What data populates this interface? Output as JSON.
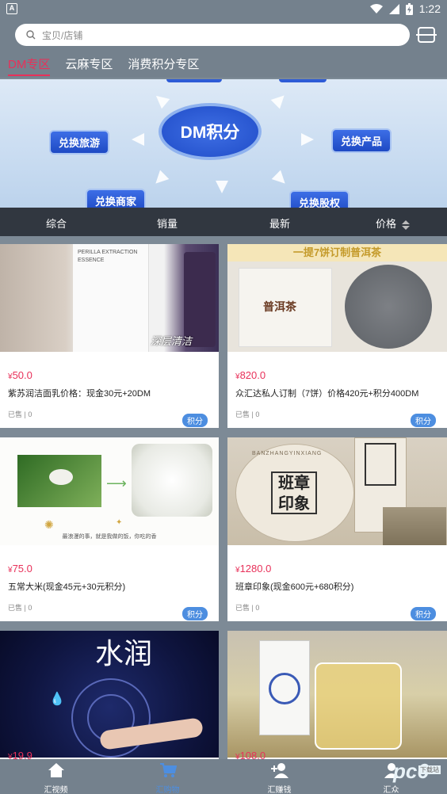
{
  "status_bar": {
    "time": "1:22",
    "notification_letter": "A"
  },
  "search": {
    "placeholder": "宝贝/店铺"
  },
  "tabs": [
    {
      "label": "DM专区",
      "active": true
    },
    {
      "label": "云麻专区",
      "active": false
    },
    {
      "label": "消费积分专区",
      "active": false
    }
  ],
  "banner": {
    "center": "DM积分",
    "pills": [
      "兑换旅游",
      "兑换商家",
      "兑换产品",
      "兑换股权"
    ]
  },
  "sort_bar": {
    "items": [
      "综合",
      "销量",
      "最新",
      "价格"
    ]
  },
  "products": [
    {
      "price": "50.0",
      "currency": "¥",
      "title": "紫苏润洁面乳价格：现金30元+20DM",
      "sold": "已售 | 0",
      "badge": "积分",
      "img_text": "深层清洁",
      "img_label": "PERILLA EXTRACTION ESSENCE"
    },
    {
      "price": "820.0",
      "currency": "¥",
      "title": "众汇达私人订制（7饼）价格420元+积分400DM",
      "sold": "已售 | 0",
      "badge": "积分",
      "img_text": "一提7饼订制普洱茶",
      "img_label": "普洱茶"
    },
    {
      "price": "75.0",
      "currency": "¥",
      "title": "五常大米(现金45元+30元积分)",
      "sold": "已售 | 0",
      "badge": "积分",
      "img_text": "最浪漫的事，就是我做的饭，你吃的香",
      "img_label": ""
    },
    {
      "price": "1280.0",
      "currency": "¥",
      "title": "班章印象(现金600元+680积分)",
      "sold": "已售 | 0",
      "badge": "积分",
      "img_text": "班章印象",
      "img_label": "BANZHANGYINXIANG"
    },
    {
      "price": "19.9",
      "currency": "¥",
      "title": "",
      "sold": "",
      "badge": "",
      "img_text": "水润",
      "img_label": ""
    },
    {
      "price": "108.0",
      "currency": "¥",
      "title": "",
      "sold": "",
      "badge": "",
      "img_text": "",
      "img_label": ""
    }
  ],
  "bottom_nav": [
    {
      "label": "汇视频",
      "icon": "home-icon",
      "active": false
    },
    {
      "label": "汇购物",
      "icon": "cart-icon",
      "active": true
    },
    {
      "label": "汇赚钱",
      "icon": "user-add-icon",
      "active": false
    },
    {
      "label": "汇众",
      "icon": "user-icon",
      "active": false
    }
  ],
  "watermark": {
    "text": "pc6",
    "sub": "下载站"
  },
  "colors": {
    "accent": "#e8315a",
    "badge": "#4d8ee0",
    "header": "#74818d",
    "sortbar": "#313740"
  }
}
